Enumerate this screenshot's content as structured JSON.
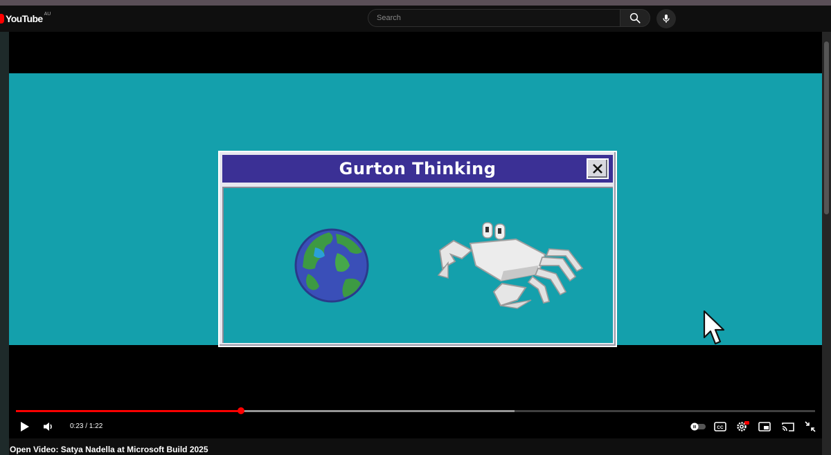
{
  "app": {
    "logo_text": "YouTube",
    "region": "AU"
  },
  "search": {
    "placeholder": "Search",
    "value": ""
  },
  "icons": {
    "search": "search-icon",
    "mic": "mic-icon",
    "play": "play-icon",
    "volume": "volume-icon",
    "autoplay": "autoplay-toggle",
    "captions": "captions-icon",
    "settings": "settings-icon",
    "miniplayer": "miniplayer-icon",
    "cast": "cast-icon",
    "fullscreen": "fullscreen-icon"
  },
  "video_frame": {
    "dialog_title": "Gurton Thinking",
    "background_color": "#14a0ac",
    "titlebar_color": "#3b3095"
  },
  "player": {
    "current_time": "0:23",
    "duration": "1:22",
    "time_display": "0:23 / 1:22",
    "progress_fraction": 0.2819,
    "buffered_fraction": 0.6235,
    "accent_color": "#ff0000",
    "settings_badge": "HD"
  },
  "video": {
    "title": "Open Video: Satya Nadella at Microsoft Build 2025"
  }
}
